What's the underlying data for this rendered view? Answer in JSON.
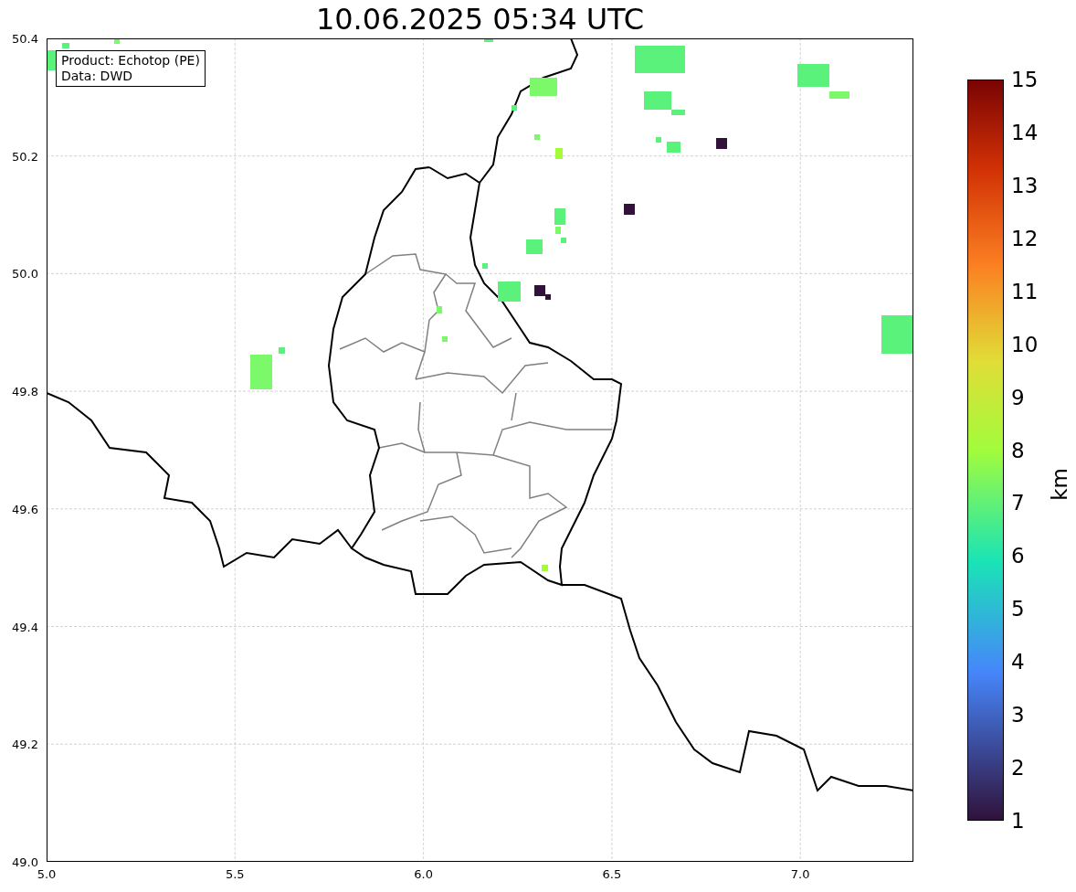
{
  "title": "10.06.2025 05:34 UTC",
  "info_box": [
    "Product: Echotop (PE)",
    "Data: DWD"
  ],
  "map": {
    "x_ticks": [
      "5.0",
      "5.5",
      "6.0",
      "6.5",
      "7.0"
    ],
    "y_ticks": [
      "50.4",
      "50.2",
      "50.0",
      "49.8",
      "49.6",
      "49.4",
      "49.2",
      "49.0"
    ]
  },
  "colorbar": {
    "label": "km",
    "ticks": [
      "15",
      "14",
      "13",
      "12",
      "11",
      "10",
      "9",
      "8",
      "7",
      "6",
      "5",
      "4",
      "3",
      "2",
      "1"
    ]
  }
}
